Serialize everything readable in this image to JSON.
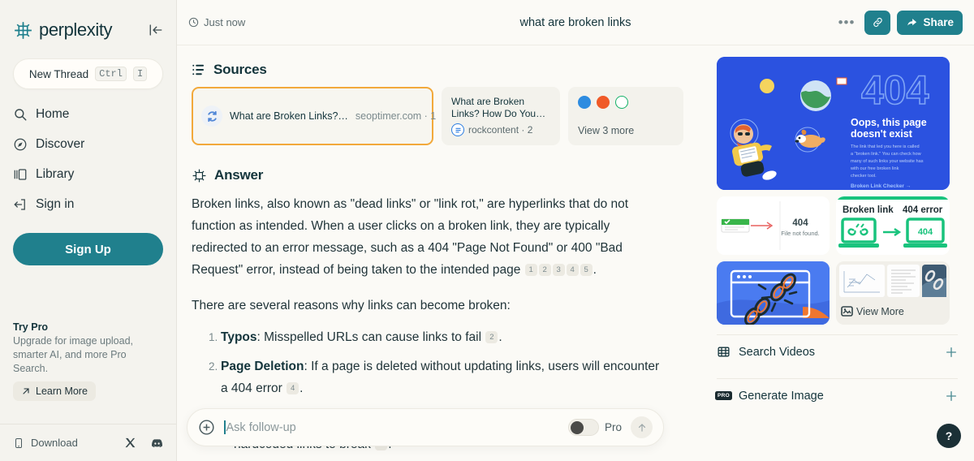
{
  "brand": {
    "name": "perplexity",
    "logo_icon": "perplexity-logo-icon",
    "collapse_icon": "collapse-sidebar-icon"
  },
  "sidebar": {
    "new_thread": {
      "label": "New Thread",
      "key_mod": "Ctrl",
      "key_letter": "I"
    },
    "items": [
      {
        "label": "Home",
        "icon": "search-icon"
      },
      {
        "label": "Discover",
        "icon": "compass-icon"
      },
      {
        "label": "Library",
        "icon": "library-icon"
      },
      {
        "label": "Sign in",
        "icon": "sign-in-icon"
      }
    ],
    "signup_label": "Sign Up",
    "try_pro": {
      "title": "Try Pro",
      "description": "Upgrade for image upload, smarter AI, and more Pro Search.",
      "learn_more_label": "Learn More",
      "learn_more_icon": "arrow-up-right-icon"
    },
    "footer": {
      "download_label": "Download",
      "download_icon": "mobile-icon",
      "social": [
        {
          "name": "x-twitter-icon"
        },
        {
          "name": "discord-icon"
        }
      ]
    }
  },
  "topbar": {
    "timestamp": "Just now",
    "clock_icon": "clock-icon",
    "title": "what are broken links",
    "more_label": "•••",
    "link_icon": "link-icon",
    "share_label": "Share",
    "share_icon": "share-arrow-icon"
  },
  "sources": {
    "heading": "Sources",
    "heading_icon": "sources-list-icon",
    "cards": [
      {
        "title": "What are Broken Links?…",
        "domain": "seoptimer.com",
        "index": "1",
        "meta": "seoptimer.com · 1",
        "favicon": "seoptimer-favicon",
        "favicon_color": "#4f86d6",
        "highlighted": true
      },
      {
        "title": "What are Broken Links? How Do You…",
        "domain": "rockcontent",
        "index": "2",
        "meta": "rockcontent · 2",
        "favicon": "rockcontent-favicon",
        "favicon_color": "#2b7de0",
        "highlighted": false
      }
    ],
    "more_card": {
      "label": "View 3 more",
      "favicons": [
        {
          "name": "favicon-blue",
          "color": "#2e8ce0"
        },
        {
          "name": "favicon-orange",
          "color": "#f05a28"
        },
        {
          "name": "favicon-green-ring",
          "color": "#17b26a"
        }
      ]
    }
  },
  "answer": {
    "heading": "Answer",
    "heading_icon": "perplexity-mark-icon",
    "paragraph_1": {
      "text_before": "Broken links, also known as \"dead links\" or \"link rot,\" are hyperlinks that do not function as intended. When a user clicks on a broken link, they are typically redirected to an error message, such as a 404 \"Page Not Found\" or 400 \"Bad Request\" error, instead of being taken to the intended page",
      "citations": [
        "1",
        "2",
        "3",
        "4",
        "5"
      ],
      "text_after": "."
    },
    "paragraph_2": "There are several reasons why links can become broken:",
    "reasons": [
      {
        "term": "Typos",
        "text": ": Misspelled URLs can cause links to fail",
        "citation": "2",
        "tail": "."
      },
      {
        "term": "Page Deletion",
        "text": ": If a page is deleted without updating links, users will encounter a 404 error",
        "citation": "4",
        "tail": "."
      }
    ],
    "partial_tail": {
      "text": "hardcoded links to break",
      "citation": "4",
      "tail": "."
    }
  },
  "followup": {
    "placeholder": "Ask follow-up",
    "add_icon": "plus-circle-icon",
    "pro_label": "Pro",
    "pro_enabled": false,
    "submit_icon": "arrow-up-icon"
  },
  "media": {
    "hero": {
      "code": "404",
      "title": "Oops, this page doesn't exist",
      "body": "The link that led you here is called a \"broken link.\" You can check how many of such links your website has with our free broken link checker tool.",
      "cta": "Broken Link Checker →",
      "bg_color": "#2b52e0"
    },
    "thumbs": [
      {
        "name": "thumb-404-file-not-found",
        "code": "404",
        "caption": "File not found."
      },
      {
        "name": "thumb-broken-link-404-error",
        "label_left": "Broken link",
        "label_right": "404 error",
        "code": "404",
        "accent": "#19c37d"
      },
      {
        "name": "thumb-broken-chain-browser"
      },
      {
        "name": "thumb-view-more",
        "view_more_label": "View More",
        "view_more_icon": "image-icon"
      }
    ],
    "actions": [
      {
        "label": "Search Videos",
        "icon": "video-grid-icon",
        "plus_icon": "plus-icon",
        "badge": null
      },
      {
        "label": "Generate Image",
        "icon": "pro-badge-icon",
        "plus_icon": "plus-icon",
        "badge": "PRO"
      }
    ]
  },
  "help": {
    "label": "?"
  },
  "colors": {
    "accent_teal": "#20808d",
    "highlight_orange": "#f2a93b",
    "page_bg": "#fbfaf6",
    "sidebar_bg": "#f4f3ee"
  }
}
